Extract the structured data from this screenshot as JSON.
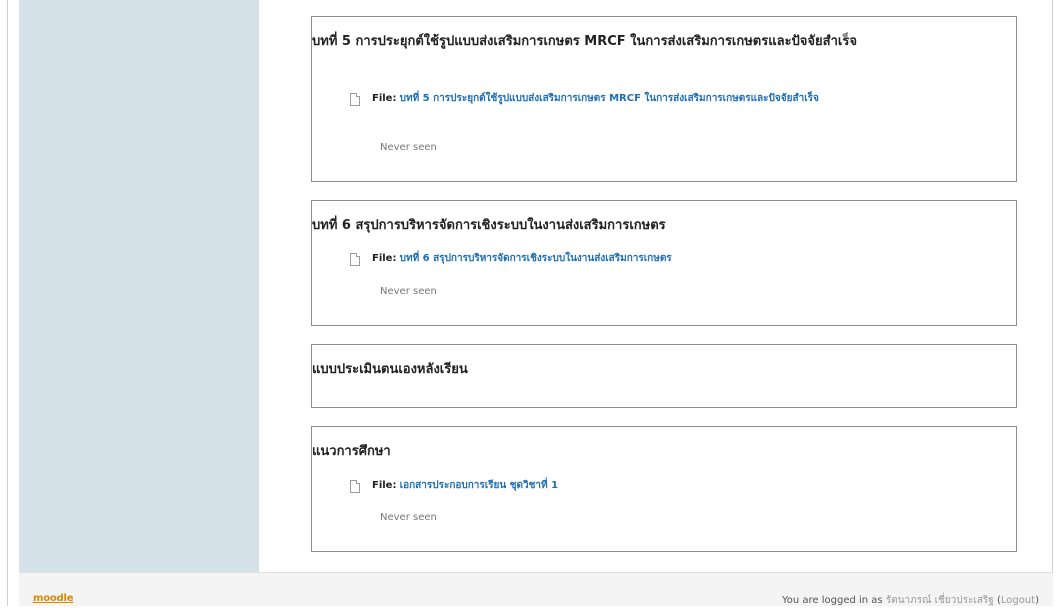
{
  "sections": [
    {
      "title": "บทที่ 5 การประยุกต์ใช้รูปแบบส่งเสริมการเกษตร MRCF ในการส่งเสริมการเกษตรและปัจจัยสำเร็จ",
      "file_prefix": "File:",
      "file_link": "บทที่ 5 การประยุกต์ใช้รูปแบบส่งเสริมการเกษตร MRCF ในการส่งเสริมการเกษตรและปัจจัยสำเร็จ",
      "status": "Never seen"
    },
    {
      "title": "บทที่ 6 สรุปการบริหารจัดการเชิงระบบในงานส่งเสริมการเกษตร",
      "file_prefix": "File:",
      "file_link": "บทที่ 6 สรุปการบริหารจัดการเชิงระบบในงานส่งเสริมการเกษตร",
      "status": "Never seen"
    },
    {
      "title": "แบบประเมินตนเองหลังเรียน"
    },
    {
      "title": "แนวการศึกษา",
      "file_prefix": "File:",
      "file_link": "เอกสารประกอบการเรียน ชุดวิชาที่ 1",
      "status": "Never seen"
    }
  ],
  "footer": {
    "logo": "moodle",
    "logged_in_text": "You are logged in as",
    "user_name": "รัตนาภรณ์ เชี่ยวประเสริฐ",
    "logout_open": "(",
    "logout_label": "Logout",
    "logout_close": ")"
  }
}
